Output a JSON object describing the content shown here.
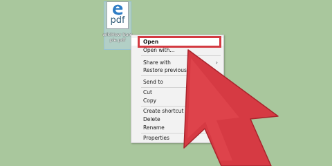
{
  "desktop": {
    "background_color": "#a9c79d"
  },
  "file": {
    "icon": "edge-pdf-icon",
    "type_label": "pdf",
    "name": "wikiHow Sample.pdf"
  },
  "context_menu": {
    "items": [
      {
        "label": "Open"
      },
      {
        "label": "Open with..."
      },
      {
        "label": "Share with",
        "submenu": true
      },
      {
        "label": "Restore previous versions"
      },
      {
        "label": "Send to"
      },
      {
        "label": "Cut"
      },
      {
        "label": "Copy"
      },
      {
        "label": "Create shortcut"
      },
      {
        "label": "Delete"
      },
      {
        "label": "Rename"
      },
      {
        "label": "Properties"
      }
    ],
    "submenu_arrow": "›"
  },
  "annotation": {
    "highlight_color": "#d33a41",
    "arrow_color": "#d63a43",
    "arrow_icon": "big-red-pointer-arrow"
  }
}
